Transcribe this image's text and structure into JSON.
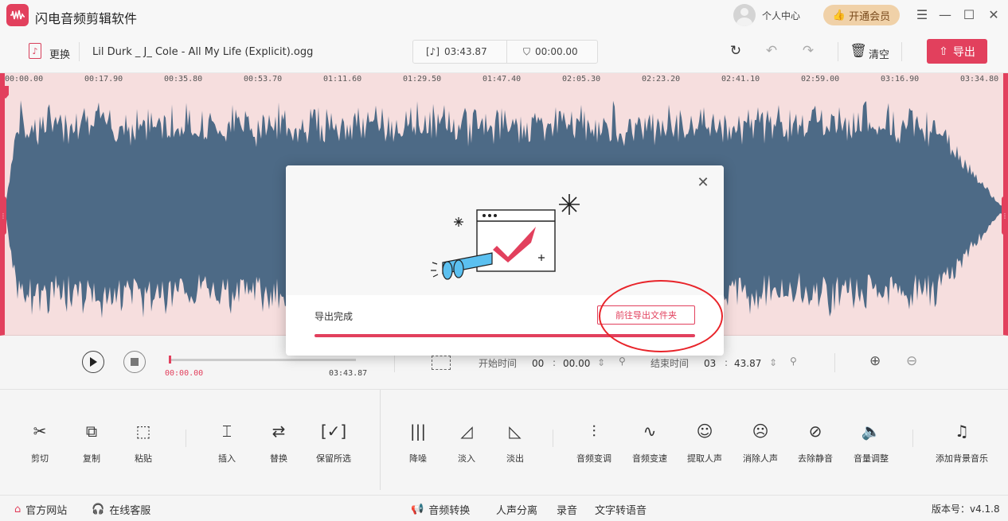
{
  "app": {
    "title": "闪电音频剪辑软件"
  },
  "header": {
    "user_center": "个人中心",
    "vip": "开通会员"
  },
  "toolbar": {
    "change_label": "更换",
    "filename": "Lil Durk _ J_ Cole - All My Life (Explicit).ogg",
    "duration": "03:43.87",
    "selection": "00:00.00",
    "clear_label": "清空",
    "export_label": "导出"
  },
  "ruler": {
    "ticks": [
      "00:00.00",
      "00:17.90",
      "00:35.80",
      "00:53.70",
      "01:11.60",
      "01:29.50",
      "01:47.40",
      "02:05.30",
      "02:23.20",
      "02:41.10",
      "02:59.00",
      "03:16.90",
      "03:34.80"
    ]
  },
  "player": {
    "current_time": "00:00.00",
    "total_time": "03:43.87",
    "start_label": "开始时间",
    "start_min": "00",
    "start_sec": "00.00",
    "end_label": "结束时间",
    "end_min": "03",
    "end_sec": "43.87"
  },
  "tools": [
    "剪切",
    "复制",
    "粘贴",
    "插入",
    "替换",
    "保留所选",
    "降噪",
    "淡入",
    "淡出",
    "音频变调",
    "音频变速",
    "提取人声",
    "消除人声",
    "去除静音",
    "音量调整",
    "添加背景音乐"
  ],
  "status": {
    "website": "官方网站",
    "service": "在线客服",
    "convert": "音频转换",
    "separate": "人声分离",
    "record": "录音",
    "tts": "文字转语音",
    "version": "版本号：v4.1.8"
  },
  "dialog": {
    "done_label": "导出完成",
    "open_folder": "前往导出文件夹",
    "progress": 1.0
  },
  "colors": {
    "accent": "#e2405d",
    "wave": "#4d6a86",
    "wave_bg": "#f6dede",
    "vip": "#f0d1a8"
  }
}
